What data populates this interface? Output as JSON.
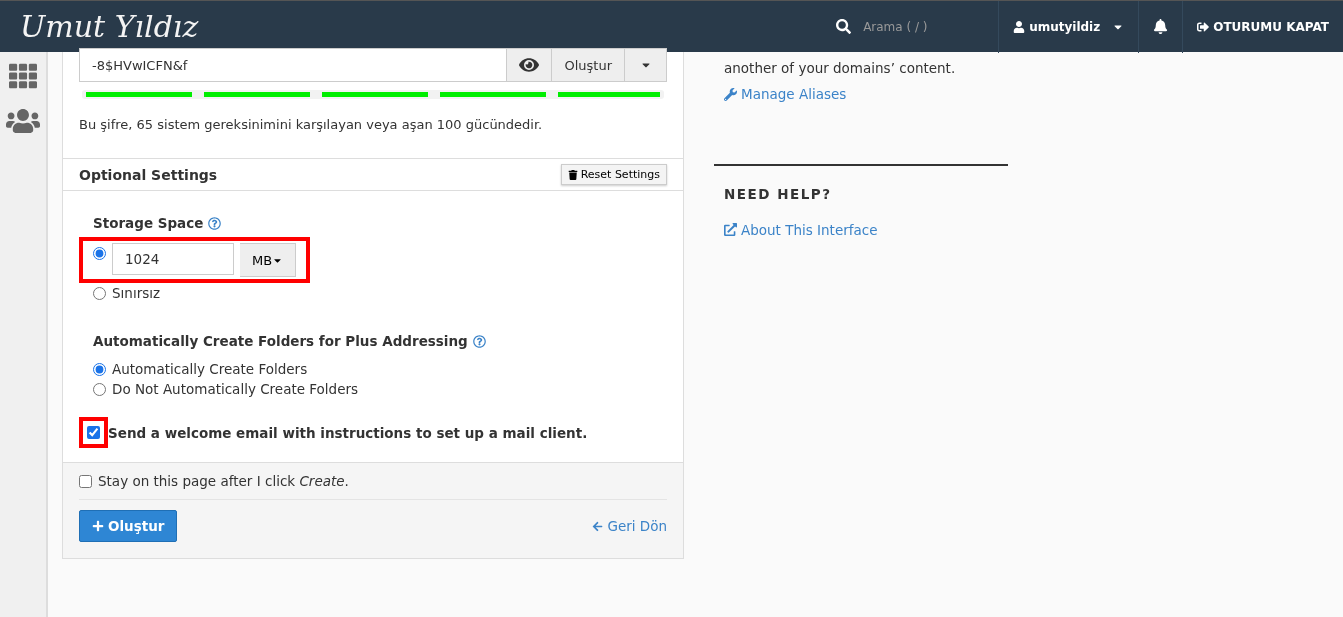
{
  "header": {
    "logo": "Umut Yıldız",
    "search": {
      "placeholder": "Arama ( / )"
    },
    "user": "umutyildiz",
    "logout": "OTURUMU KAPAT"
  },
  "password": {
    "value": "-8$HVwICFN&f",
    "generate": "Oluştur",
    "strength": {
      "level": 1
    },
    "message": "Bu şifre, 65 sistem gereksinimini karşılayan veya aşan 100 gücündedir."
  },
  "optional_settings": {
    "title": "Optional Settings",
    "reset": "Reset Settings",
    "storage": {
      "label": "Storage Space",
      "highlighted": true,
      "options": [
        {
          "kind": "quota",
          "selected": true,
          "value": "1024",
          "unit": "MB"
        },
        {
          "kind": "plain",
          "selected": false,
          "label": "Sınırsız"
        }
      ]
    },
    "folders": {
      "label": "Automatically Create Folders for Plus Addressing",
      "options": [
        {
          "label": "Automatically Create Folders",
          "selected": true
        },
        {
          "label": "Do Not Automatically Create Folders",
          "selected": false
        }
      ]
    },
    "welcome": {
      "label": "Send a welcome email with instructions to set up a mail client.",
      "checked": true,
      "highlighted": true
    }
  },
  "footer": {
    "stay": {
      "label": "Stay on this page after I click *Create*.",
      "checked": false
    },
    "create": "Oluştur",
    "back": "Geri Dön"
  },
  "aside": {
    "text": "another of your domains’ content.",
    "link": "Manage Aliases",
    "help_title": "NEED HELP?",
    "help_link": "About This Interface"
  }
}
